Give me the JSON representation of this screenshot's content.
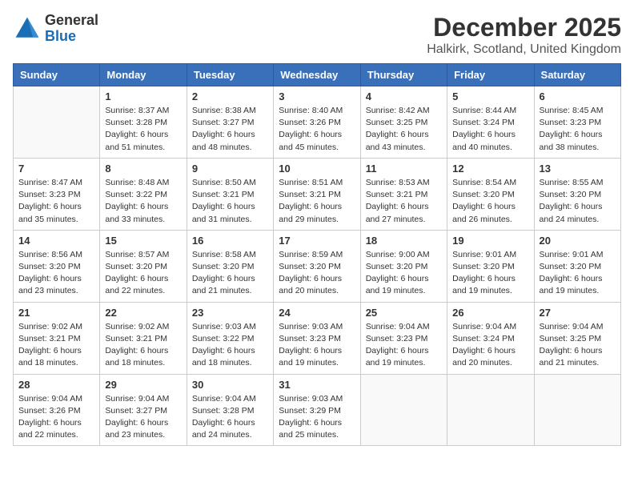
{
  "header": {
    "logo_general": "General",
    "logo_blue": "Blue",
    "title": "December 2025",
    "location": "Halkirk, Scotland, United Kingdom"
  },
  "days_of_week": [
    "Sunday",
    "Monday",
    "Tuesday",
    "Wednesday",
    "Thursday",
    "Friday",
    "Saturday"
  ],
  "weeks": [
    [
      {
        "day": "",
        "info": ""
      },
      {
        "day": "1",
        "info": "Sunrise: 8:37 AM\nSunset: 3:28 PM\nDaylight: 6 hours\nand 51 minutes."
      },
      {
        "day": "2",
        "info": "Sunrise: 8:38 AM\nSunset: 3:27 PM\nDaylight: 6 hours\nand 48 minutes."
      },
      {
        "day": "3",
        "info": "Sunrise: 8:40 AM\nSunset: 3:26 PM\nDaylight: 6 hours\nand 45 minutes."
      },
      {
        "day": "4",
        "info": "Sunrise: 8:42 AM\nSunset: 3:25 PM\nDaylight: 6 hours\nand 43 minutes."
      },
      {
        "day": "5",
        "info": "Sunrise: 8:44 AM\nSunset: 3:24 PM\nDaylight: 6 hours\nand 40 minutes."
      },
      {
        "day": "6",
        "info": "Sunrise: 8:45 AM\nSunset: 3:23 PM\nDaylight: 6 hours\nand 38 minutes."
      }
    ],
    [
      {
        "day": "7",
        "info": "Sunrise: 8:47 AM\nSunset: 3:23 PM\nDaylight: 6 hours\nand 35 minutes."
      },
      {
        "day": "8",
        "info": "Sunrise: 8:48 AM\nSunset: 3:22 PM\nDaylight: 6 hours\nand 33 minutes."
      },
      {
        "day": "9",
        "info": "Sunrise: 8:50 AM\nSunset: 3:21 PM\nDaylight: 6 hours\nand 31 minutes."
      },
      {
        "day": "10",
        "info": "Sunrise: 8:51 AM\nSunset: 3:21 PM\nDaylight: 6 hours\nand 29 minutes."
      },
      {
        "day": "11",
        "info": "Sunrise: 8:53 AM\nSunset: 3:21 PM\nDaylight: 6 hours\nand 27 minutes."
      },
      {
        "day": "12",
        "info": "Sunrise: 8:54 AM\nSunset: 3:20 PM\nDaylight: 6 hours\nand 26 minutes."
      },
      {
        "day": "13",
        "info": "Sunrise: 8:55 AM\nSunset: 3:20 PM\nDaylight: 6 hours\nand 24 minutes."
      }
    ],
    [
      {
        "day": "14",
        "info": "Sunrise: 8:56 AM\nSunset: 3:20 PM\nDaylight: 6 hours\nand 23 minutes."
      },
      {
        "day": "15",
        "info": "Sunrise: 8:57 AM\nSunset: 3:20 PM\nDaylight: 6 hours\nand 22 minutes."
      },
      {
        "day": "16",
        "info": "Sunrise: 8:58 AM\nSunset: 3:20 PM\nDaylight: 6 hours\nand 21 minutes."
      },
      {
        "day": "17",
        "info": "Sunrise: 8:59 AM\nSunset: 3:20 PM\nDaylight: 6 hours\nand 20 minutes."
      },
      {
        "day": "18",
        "info": "Sunrise: 9:00 AM\nSunset: 3:20 PM\nDaylight: 6 hours\nand 19 minutes."
      },
      {
        "day": "19",
        "info": "Sunrise: 9:01 AM\nSunset: 3:20 PM\nDaylight: 6 hours\nand 19 minutes."
      },
      {
        "day": "20",
        "info": "Sunrise: 9:01 AM\nSunset: 3:20 PM\nDaylight: 6 hours\nand 19 minutes."
      }
    ],
    [
      {
        "day": "21",
        "info": "Sunrise: 9:02 AM\nSunset: 3:21 PM\nDaylight: 6 hours\nand 18 minutes."
      },
      {
        "day": "22",
        "info": "Sunrise: 9:02 AM\nSunset: 3:21 PM\nDaylight: 6 hours\nand 18 minutes."
      },
      {
        "day": "23",
        "info": "Sunrise: 9:03 AM\nSunset: 3:22 PM\nDaylight: 6 hours\nand 18 minutes."
      },
      {
        "day": "24",
        "info": "Sunrise: 9:03 AM\nSunset: 3:23 PM\nDaylight: 6 hours\nand 19 minutes."
      },
      {
        "day": "25",
        "info": "Sunrise: 9:04 AM\nSunset: 3:23 PM\nDaylight: 6 hours\nand 19 minutes."
      },
      {
        "day": "26",
        "info": "Sunrise: 9:04 AM\nSunset: 3:24 PM\nDaylight: 6 hours\nand 20 minutes."
      },
      {
        "day": "27",
        "info": "Sunrise: 9:04 AM\nSunset: 3:25 PM\nDaylight: 6 hours\nand 21 minutes."
      }
    ],
    [
      {
        "day": "28",
        "info": "Sunrise: 9:04 AM\nSunset: 3:26 PM\nDaylight: 6 hours\nand 22 minutes."
      },
      {
        "day": "29",
        "info": "Sunrise: 9:04 AM\nSunset: 3:27 PM\nDaylight: 6 hours\nand 23 minutes."
      },
      {
        "day": "30",
        "info": "Sunrise: 9:04 AM\nSunset: 3:28 PM\nDaylight: 6 hours\nand 24 minutes."
      },
      {
        "day": "31",
        "info": "Sunrise: 9:03 AM\nSunset: 3:29 PM\nDaylight: 6 hours\nand 25 minutes."
      },
      {
        "day": "",
        "info": ""
      },
      {
        "day": "",
        "info": ""
      },
      {
        "day": "",
        "info": ""
      }
    ]
  ]
}
